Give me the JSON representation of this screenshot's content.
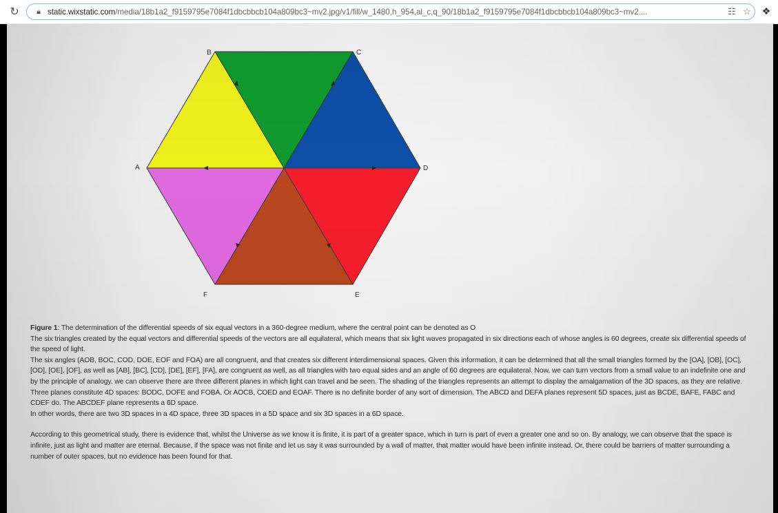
{
  "browser": {
    "reload_icon": "reload-icon",
    "lock_icon": "lock-icon",
    "url_host": "static.wixstatic.com",
    "url_path": "/media/18b1a2_f9159795e7084f1dbcbbcb104a809bc3~mv2.jpg/v1/fill/w_1480,h_954,al_c,q_90/18b1a2_f9159795e7084f1dbcbbcb104a809bc3~mv2....",
    "qr_icon": "qr-code-icon",
    "star_icon": "bookmark-star-icon",
    "extension_icon": "extension-puzzle-icon"
  },
  "figure": {
    "vertices": {
      "A": "A",
      "B": "B",
      "C": "C",
      "D": "D",
      "E": "E",
      "F": "F"
    },
    "triangle_colors": {
      "OBC": "#0f9a2e",
      "OCD": "#0c4fa6",
      "ODE": "#f51d2b",
      "OEF": "#b9461f",
      "OFA": "#e069df",
      "OAB": "#eef01c"
    }
  },
  "caption": {
    "figure_label": "Figure 1",
    "figure_text": ": The determination of the differential speeds of six equal vectors in a 360-degree medium, where the central point can be denoted as O",
    "p1": "The six triangles created by the equal vectors and differential speeds of the vectors are all equilateral, which means that six light waves propagated in six directions each of whose angles is 60 degrees, create six differential speeds of the speed of light.",
    "p2": "The six angles (AOB, BOC, COD, DOE, EOF and FOA) are all congruent, and that creates six different interdimensional spaces. Given this information, it can be determined that all the small triangles formed by the [OA], [OB], [OC], [OD], [OE], [OF], as well as [AB], [BC], [CD], [DE], [EF], [FA], are congruent as well, as all triangles with two equal sides and an angle of 60 degrees are equilateral. Now, we can turn vectors from a small value to an indefinite one and by the principle of analogy, we can observe there are three different planes in which light can travel and be seen. The shading of the triangles represents an attempt to display the amalgamation of the 3D spaces, as they are relative.",
    "p3": "Three planes constitute 4D spaces: BODC, DOFE and FOBA. Or AOCB, COED and EOAF. There is no definite border of any sort of dimension.  The ABCD and DEFA planes represent 5D spaces, just as BCDE, BAFE, FABC and CDEF do. The ABCDEF plane represents a 6D space.",
    "p4": "In other words, there are two 3D spaces in a 4D space, three 3D spaces in a 5D space and six 3D spaces in a 6D space.",
    "p5": "According to this geometrical study, there is evidence that, whilst the Universe as we know it is finite, it is part of a greater space, which in turn is part of even a greater one and so on. By analogy, we can observe that the space is infinite, just as light and matter are eternal. Because, if the space was not finite and let us say it was surrounded by a wall of matter, that matter would have been infinite instead. Or, there could be barriers of matter surrounding a number of outer spaces, but no evidence has been found for that."
  }
}
